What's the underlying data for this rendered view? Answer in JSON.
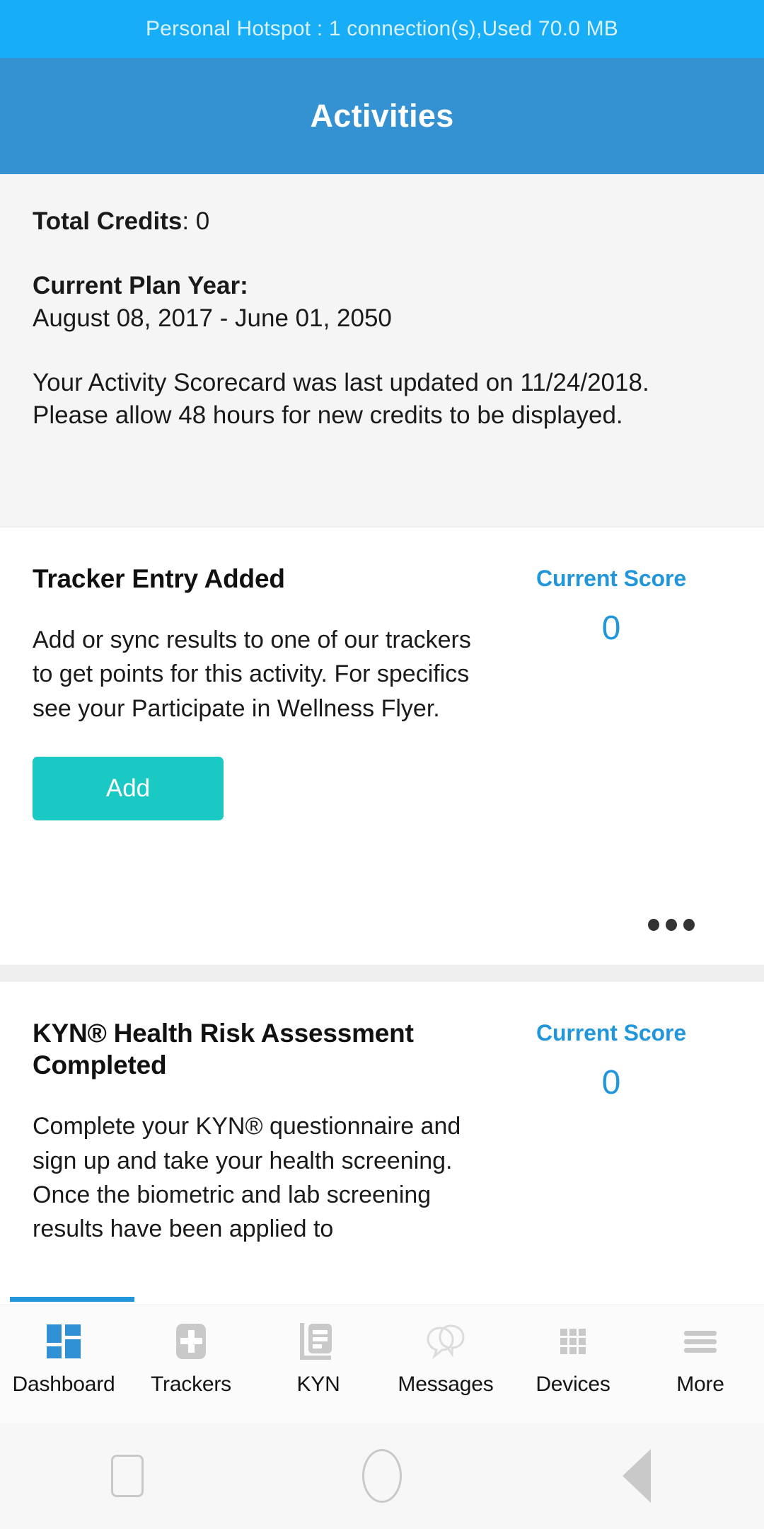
{
  "status_bar": {
    "text": "Personal Hotspot : 1 connection(s),Used  70.0 MB",
    "background": "#17adf7"
  },
  "app_bar": {
    "title": "Activities",
    "background": "#3492d3"
  },
  "summary": {
    "total_credits_label": "Total Credits",
    "total_credits_value": ": 0",
    "plan_year_label": "Current Plan Year",
    "plan_year_colon": ":",
    "plan_year_value": "August 08, 2017 - June 01, 2050",
    "update_note": "Your Activity Scorecard was last updated on 11/24/2018. Please allow 48 hours for new credits to be displayed."
  },
  "activities": [
    {
      "title": "Tracker Entry Added",
      "description": "Add or sync results to one of our trackers to get points for this activity. For specifics see your Participate in Wellness Flyer.",
      "score_label": "Current Score",
      "score_value": "0",
      "action_label": "Add",
      "overflow_label": "•••"
    },
    {
      "title": "KYN® Health Risk Assessment Completed",
      "description": "Complete your KYN® questionnaire and sign up and take your health screening. Once the biometric and lab screening results have been applied to",
      "score_label": "Current Score",
      "score_value": "0"
    }
  ],
  "colors": {
    "accent_blue": "#2196db",
    "status_blue": "#17adf7",
    "header_blue": "#3492d3",
    "button_teal": "#1bc9c4",
    "panel_gray": "#f5f5f5",
    "divider_gray": "#efefef"
  },
  "bottom_nav": {
    "items": [
      {
        "label": "Dashboard",
        "icon": "dashboard-grid-icon",
        "active": true
      },
      {
        "label": "Trackers",
        "icon": "plus-square-icon",
        "active": false
      },
      {
        "label": "KYN",
        "icon": "document-lines-icon",
        "active": false
      },
      {
        "label": "Messages",
        "icon": "chat-bubbles-icon",
        "active": false
      },
      {
        "label": "Devices",
        "icon": "grid-dots-icon",
        "active": false
      },
      {
        "label": "More",
        "icon": "hamburger-lines-icon",
        "active": false
      }
    ]
  },
  "system_nav": {
    "recents": "recents-square-icon",
    "home": "home-circle-icon",
    "back": "back-triangle-icon"
  }
}
